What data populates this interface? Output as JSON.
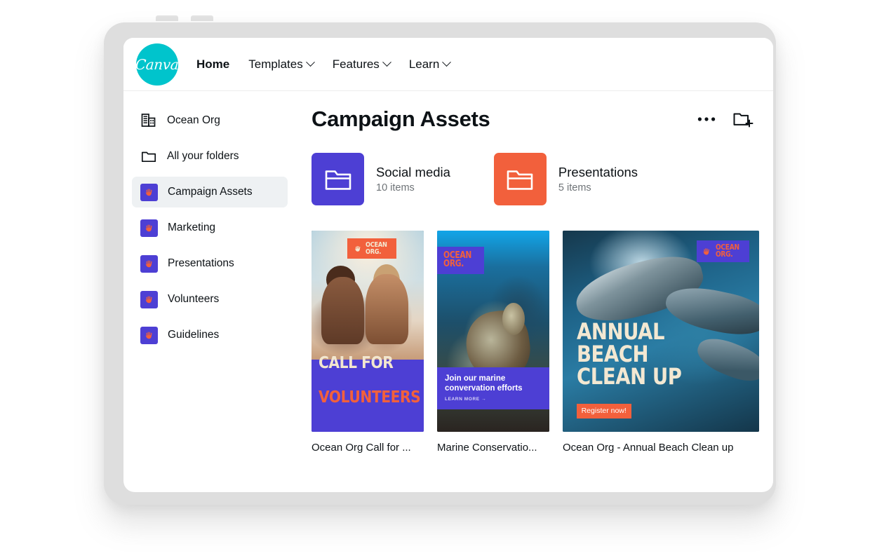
{
  "brand": {
    "logo_text": "Canva",
    "teal": "#00c4cc",
    "purple": "#4d3fd4",
    "orange": "#f2603c",
    "cream": "#f3e8d2"
  },
  "nav": {
    "items": [
      {
        "label": "Home",
        "has_chevron": false,
        "active": true
      },
      {
        "label": "Templates",
        "has_chevron": true,
        "active": false
      },
      {
        "label": "Features",
        "has_chevron": true,
        "active": false
      },
      {
        "label": "Learn",
        "has_chevron": true,
        "active": false
      }
    ]
  },
  "sidebar": {
    "items": [
      {
        "label": "Ocean Org",
        "icon": "building-icon",
        "selected": false
      },
      {
        "label": "All your folders",
        "icon": "folder-outline-icon",
        "selected": false
      },
      {
        "label": "Campaign Assets",
        "icon": "ocean-org-hand-icon",
        "selected": true
      },
      {
        "label": "Marketing",
        "icon": "ocean-org-hand-icon",
        "selected": false
      },
      {
        "label": "Presentations",
        "icon": "ocean-org-hand-icon",
        "selected": false
      },
      {
        "label": "Volunteers",
        "icon": "ocean-org-hand-icon",
        "selected": false
      },
      {
        "label": "Guidelines",
        "icon": "ocean-org-hand-icon",
        "selected": false
      }
    ]
  },
  "main": {
    "title": "Campaign Assets",
    "actions": [
      {
        "name": "more-options-icon",
        "label": "..."
      },
      {
        "name": "new-folder-icon",
        "label": "New folder"
      }
    ],
    "folders": [
      {
        "name": "Social media",
        "count": "10 items",
        "color": "#4d3fd4"
      },
      {
        "name": "Presentations",
        "count": "5 items",
        "color": "#f2603c"
      }
    ],
    "designs": [
      {
        "caption": "Ocean Org Call for ...",
        "shape": "portrait",
        "logo_text_line1": "OCEAN",
        "logo_text_line2": "ORG.",
        "headline": "CALL FOR",
        "subhead": "VOLUNTEERS"
      },
      {
        "caption": "Marine Conservatio...",
        "shape": "portrait",
        "logo_text_line1": "OCEAN",
        "logo_text_line2": "ORG.",
        "band_title_line1": "Join our marine",
        "band_title_line2": "convervation efforts",
        "band_cta": "LEARN MORE  →"
      },
      {
        "caption": "Ocean Org - Annual Beach Clean up",
        "shape": "square",
        "logo_text_line1": "OCEAN",
        "logo_text_line2": "ORG.",
        "headline_line1": "ANNUAL",
        "headline_line2": "BEACH",
        "headline_line3": "CLEAN UP",
        "button_label": "Register now!"
      }
    ]
  }
}
